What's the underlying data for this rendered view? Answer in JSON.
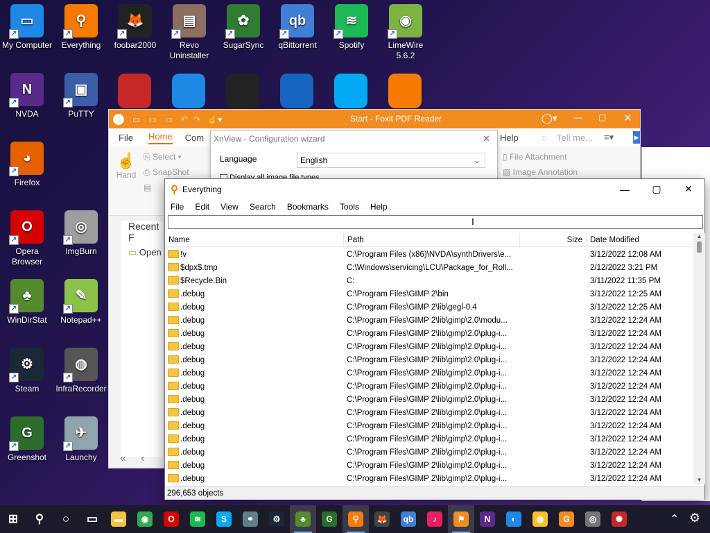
{
  "desktop": {
    "icons": [
      {
        "label": "My Computer",
        "color": "#1e88e5",
        "glyph": "▭"
      },
      {
        "label": "Everything",
        "color": "#f57c00",
        "glyph": "⚲"
      },
      {
        "label": "foobar2000",
        "color": "#222222",
        "glyph": "🦊"
      },
      {
        "label": "Revo Uninstaller",
        "color": "#8d6e63",
        "glyph": "▤"
      },
      {
        "label": "SugarSync",
        "color": "#2e7d32",
        "glyph": "✿"
      },
      {
        "label": "qBittorrent",
        "color": "#3f7fd6",
        "glyph": "qb"
      },
      {
        "label": "Spotify",
        "color": "#1db954",
        "glyph": "≋"
      },
      {
        "label": "LimeWire 5.6.2",
        "color": "#7cb342",
        "glyph": "◉"
      },
      {
        "label": "NVDA",
        "color": "#5a2a8a",
        "glyph": "N"
      },
      {
        "label": "PuTTY",
        "color": "#3b5ea8",
        "glyph": "▣"
      },
      {
        "label": "Firefox",
        "color": "#e66000",
        "glyph": "◕"
      },
      {
        "label": "Opera Browser",
        "color": "#d50000",
        "glyph": "O"
      },
      {
        "label": "ImgBurn",
        "color": "#9e9e9e",
        "glyph": "◎"
      },
      {
        "label": "WinDirStat",
        "color": "#558b2f",
        "glyph": "♣"
      },
      {
        "label": "Notepad++",
        "color": "#8bc34a",
        "glyph": "✎"
      },
      {
        "label": "Steam",
        "color": "#1b2838",
        "glyph": "⚙"
      },
      {
        "label": "InfraRecorder",
        "color": "#555555",
        "glyph": "◍"
      },
      {
        "label": "Greenshot",
        "color": "#2b6e2b",
        "glyph": "G"
      },
      {
        "label": "Launchy",
        "color": "#90a4ae",
        "glyph": "✈"
      }
    ],
    "partial_icons": [
      {
        "name": "xnview",
        "color": "#c62828"
      },
      {
        "name": "vnc-viewer",
        "color": "#1e88e5"
      },
      {
        "name": "winamp",
        "color": "#222222"
      },
      {
        "name": "audacity",
        "color": "#1565c0"
      },
      {
        "name": "skype",
        "color": "#03a9f4"
      },
      {
        "name": "vlc",
        "color": "#f57c00"
      }
    ]
  },
  "foxit": {
    "title": "Start - Foxit PDF Reader",
    "menu": {
      "file": "File",
      "home": "Home",
      "comment": "Com",
      "help": "Help",
      "tell_me": "Tell me..."
    },
    "ribbon": {
      "hand": "Hand",
      "select": "Select",
      "snapshot": "SnapShot",
      "file_attachment": "File Attachment",
      "image_annotation": "Image Annotation"
    },
    "recent_label": "Recent F",
    "open_label": "Open"
  },
  "xnview": {
    "title": "XnView - Configuration wizard",
    "language_label": "Language",
    "language_value": "English",
    "display_all_label": "Display all image file types"
  },
  "everything": {
    "title": "Everything",
    "menu": [
      "File",
      "Edit",
      "View",
      "Search",
      "Bookmarks",
      "Tools",
      "Help"
    ],
    "search_value": "",
    "columns": {
      "name": "Name",
      "path": "Path",
      "size": "Size",
      "date": "Date Modified"
    },
    "rows": [
      {
        "name": "!v",
        "path": "C:\\Program Files (x86)\\NVDA\\synthDrivers\\e...",
        "size": "",
        "date": "3/12/2022 12:08 AM"
      },
      {
        "name": "$dpx$.tmp",
        "path": "C:\\Windows\\servicing\\LCU\\Package_for_Roll...",
        "size": "",
        "date": "2/12/2022 3:21 PM"
      },
      {
        "name": "$Recycle.Bin",
        "path": "C:",
        "size": "",
        "date": "3/11/2022 11:35 PM"
      },
      {
        "name": ".debug",
        "path": "C:\\Program Files\\GIMP 2\\bin",
        "size": "",
        "date": "3/12/2022 12:25 AM"
      },
      {
        "name": ".debug",
        "path": "C:\\Program Files\\GIMP 2\\lib\\gegl-0.4",
        "size": "",
        "date": "3/12/2022 12:25 AM"
      },
      {
        "name": ".debug",
        "path": "C:\\Program Files\\GIMP 2\\lib\\gimp\\2.0\\modu...",
        "size": "",
        "date": "3/12/2022 12:24 AM"
      },
      {
        "name": ".debug",
        "path": "C:\\Program Files\\GIMP 2\\lib\\gimp\\2.0\\plug-i...",
        "size": "",
        "date": "3/12/2022 12:24 AM"
      },
      {
        "name": ".debug",
        "path": "C:\\Program Files\\GIMP 2\\lib\\gimp\\2.0\\plug-i...",
        "size": "",
        "date": "3/12/2022 12:24 AM"
      },
      {
        "name": ".debug",
        "path": "C:\\Program Files\\GIMP 2\\lib\\gimp\\2.0\\plug-i...",
        "size": "",
        "date": "3/12/2022 12:24 AM"
      },
      {
        "name": ".debug",
        "path": "C:\\Program Files\\GIMP 2\\lib\\gimp\\2.0\\plug-i...",
        "size": "",
        "date": "3/12/2022 12:24 AM"
      },
      {
        "name": ".debug",
        "path": "C:\\Program Files\\GIMP 2\\lib\\gimp\\2.0\\plug-i...",
        "size": "",
        "date": "3/12/2022 12:24 AM"
      },
      {
        "name": ".debug",
        "path": "C:\\Program Files\\GIMP 2\\lib\\gimp\\2.0\\plug-i...",
        "size": "",
        "date": "3/12/2022 12:24 AM"
      },
      {
        "name": ".debug",
        "path": "C:\\Program Files\\GIMP 2\\lib\\gimp\\2.0\\plug-i...",
        "size": "",
        "date": "3/12/2022 12:24 AM"
      },
      {
        "name": ".debug",
        "path": "C:\\Program Files\\GIMP 2\\lib\\gimp\\2.0\\plug-i...",
        "size": "",
        "date": "3/12/2022 12:24 AM"
      },
      {
        "name": ".debug",
        "path": "C:\\Program Files\\GIMP 2\\lib\\gimp\\2.0\\plug-i...",
        "size": "",
        "date": "3/12/2022 12:24 AM"
      },
      {
        "name": ".debug",
        "path": "C:\\Program Files\\GIMP 2\\lib\\gimp\\2.0\\plug-i...",
        "size": "",
        "date": "3/12/2022 12:24 AM"
      },
      {
        "name": ".debug",
        "path": "C:\\Program Files\\GIMP 2\\lib\\gimp\\2.0\\plug-i...",
        "size": "",
        "date": "3/12/2022 12:24 AM"
      },
      {
        "name": ".debug",
        "path": "C:\\Program Files\\GIMP 2\\lib\\gimp\\2.0\\plug-i...",
        "size": "",
        "date": "3/12/2022 12:24 AM"
      }
    ],
    "status": "296,653 objects"
  },
  "taskbar": {
    "items": [
      {
        "name": "start-button",
        "color": "#ffffff",
        "glyph": "⊞"
      },
      {
        "name": "search-icon",
        "color": "#ffffff",
        "glyph": "⚲"
      },
      {
        "name": "cortana-icon",
        "color": "#ffffff",
        "glyph": "○"
      },
      {
        "name": "task-view-icon",
        "color": "#ffffff",
        "glyph": "▭"
      },
      {
        "name": "file-explorer-icon",
        "color": "#f5c542",
        "glyph": "▬"
      },
      {
        "name": "chrome-icon",
        "color": "#34a853",
        "glyph": "◉"
      },
      {
        "name": "opera-icon",
        "color": "#d50000",
        "glyph": "O"
      },
      {
        "name": "spotify-icon",
        "color": "#1db954",
        "glyph": "≋"
      },
      {
        "name": "skype-icon",
        "color": "#03a9f4",
        "glyph": "S"
      },
      {
        "name": "network-tool-icon",
        "color": "#607d8b",
        "glyph": "⚭"
      },
      {
        "name": "steam-icon",
        "color": "#1b2838",
        "glyph": "⚙"
      },
      {
        "name": "windirstat-icon",
        "color": "#558b2f",
        "glyph": "♣",
        "active": true
      },
      {
        "name": "greenshot-icon",
        "color": "#2b6e2b",
        "glyph": "G"
      },
      {
        "name": "everything-icon",
        "color": "#f57c00",
        "glyph": "⚲",
        "active": true
      },
      {
        "name": "foobar-icon",
        "color": "#444444",
        "glyph": "🦊"
      },
      {
        "name": "qbittorrent-icon",
        "color": "#3f7fd6",
        "glyph": "qb"
      },
      {
        "name": "itunes-icon",
        "color": "#e91e63",
        "glyph": "♪"
      },
      {
        "name": "foxit-icon",
        "color": "#f08c20",
        "glyph": "⚑",
        "active": true
      },
      {
        "name": "nvda-taskbar-icon",
        "color": "#5a2a8a",
        "glyph": "N"
      },
      {
        "name": "app-icon-1",
        "color": "#1e88e5",
        "glyph": "◐"
      },
      {
        "name": "app-icon-2",
        "color": "#fbc02d",
        "glyph": "◍"
      },
      {
        "name": "foxit-pdf-icon",
        "color": "#f08c20",
        "glyph": "G"
      },
      {
        "name": "app-icon-3",
        "color": "#777777",
        "glyph": "◎"
      },
      {
        "name": "xnview-icon",
        "color": "#c62828",
        "glyph": "✺"
      }
    ],
    "tray_up": "⌃",
    "tray_gear": "⚙"
  }
}
